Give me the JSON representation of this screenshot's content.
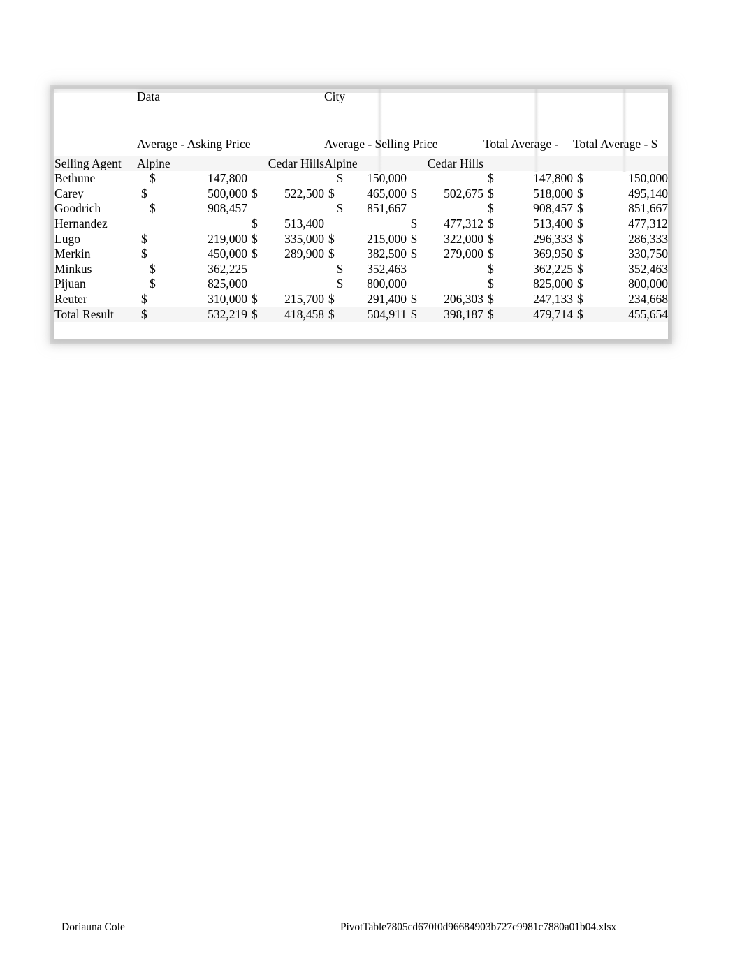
{
  "document": {
    "type": "excel-pivot-table-print",
    "footer_left": "Doriauna Cole",
    "footer_center": "PivotTable7805cd670f0d96684903b727c9981c7880a01b04.xlsx"
  },
  "pivot": {
    "field_data_label": "Data",
    "field_city_label": "City",
    "row_field_label": "Selling Agent",
    "measure_groups": [
      {
        "label": "Average - Asking Price"
      },
      {
        "label": "Average - Selling Price"
      },
      {
        "label": "Total Average - "
      },
      {
        "label": "Total Average - S"
      }
    ],
    "city_headers": [
      "Alpine",
      "Cedar Hills",
      "Alpine",
      "Cedar Hills"
    ],
    "currency_symbol": "$",
    "columns": [
      "Selling Agent",
      "Average - Asking Price / Alpine",
      "Average - Asking Price / Cedar Hills",
      "Average - Selling Price / Alpine",
      "Average - Selling Price / Cedar Hills",
      "Total Average - Asking Price",
      "Total Average - Selling Price"
    ],
    "rows": [
      {
        "agent": "Bethune",
        "ask_alpine": "147,800",
        "ask_cedar": "",
        "sell_alpine": "150,000",
        "sell_cedar": "",
        "total_ask": "147,800",
        "total_sell": "150,000"
      },
      {
        "agent": "Carey",
        "ask_alpine": "500,000",
        "ask_cedar": "522,500",
        "sell_alpine": "465,000",
        "sell_cedar": "502,675",
        "total_ask": "518,000",
        "total_sell": "495,140"
      },
      {
        "agent": "Goodrich",
        "ask_alpine": "908,457",
        "ask_cedar": "",
        "sell_alpine": "851,667",
        "sell_cedar": "",
        "total_ask": "908,457",
        "total_sell": "851,667"
      },
      {
        "agent": "Hernandez",
        "ask_alpine": "",
        "ask_cedar": "513,400",
        "sell_alpine": "",
        "sell_cedar": "477,312",
        "total_ask": "513,400",
        "total_sell": "477,312"
      },
      {
        "agent": "Lugo",
        "ask_alpine": "219,000",
        "ask_cedar": "335,000",
        "sell_alpine": "215,000",
        "sell_cedar": "322,000",
        "total_ask": "296,333",
        "total_sell": "286,333"
      },
      {
        "agent": "Merkin",
        "ask_alpine": "450,000",
        "ask_cedar": "289,900",
        "sell_alpine": "382,500",
        "sell_cedar": "279,000",
        "total_ask": "369,950",
        "total_sell": "330,750"
      },
      {
        "agent": "Minkus",
        "ask_alpine": "362,225",
        "ask_cedar": "",
        "sell_alpine": "352,463",
        "sell_cedar": "",
        "total_ask": "362,225",
        "total_sell": "352,463"
      },
      {
        "agent": "Pijuan",
        "ask_alpine": "825,000",
        "ask_cedar": "",
        "sell_alpine": "800,000",
        "sell_cedar": "",
        "total_ask": "825,000",
        "total_sell": "800,000"
      },
      {
        "agent": "Reuter",
        "ask_alpine": "310,000",
        "ask_cedar": "215,700",
        "sell_alpine": "291,400",
        "sell_cedar": "206,303",
        "total_ask": "247,133",
        "total_sell": "234,668"
      },
      {
        "agent": "Total Result",
        "ask_alpine": "532,219",
        "ask_cedar": "418,458",
        "sell_alpine": "504,911",
        "sell_cedar": "398,187",
        "total_ask": "479,714",
        "total_sell": "455,654"
      }
    ]
  }
}
